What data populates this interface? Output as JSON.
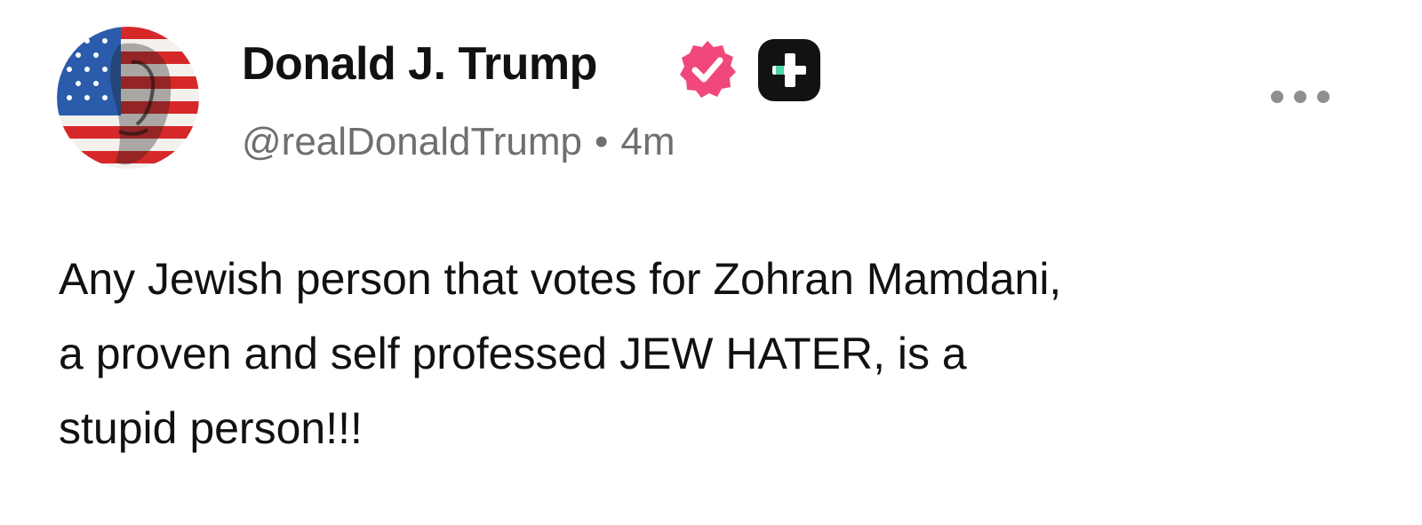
{
  "author": {
    "display_name": "Donald J. Trump",
    "handle": "@realDonaldTrump",
    "separator": "•",
    "time_ago": "4m",
    "verified_badge_icon": "verified-check-icon",
    "plus_badge_icon": "plus-icon",
    "badge_color": "#f0487a"
  },
  "post": {
    "lines": [
      "Any Jewish person that votes for Zohran Mamdani,",
      "a proven and self professed JEW HATER, is a",
      "stupid person!!!"
    ]
  },
  "menu": {
    "icon": "more-horizontal-icon"
  },
  "colors": {
    "background": "#ffffff",
    "text": "#111111",
    "secondary_text": "#6f6f73",
    "accent": "#4ad6a8"
  }
}
